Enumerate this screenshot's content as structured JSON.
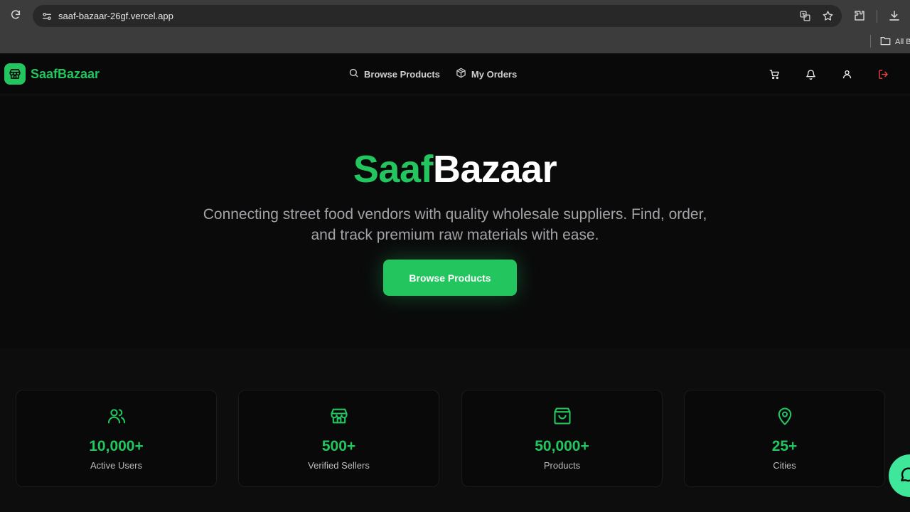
{
  "browser": {
    "url": "saaf-bazaar-26gf.vercel.app",
    "bookmarks_label": "All B"
  },
  "navbar": {
    "brand": "SaafBazaar",
    "links": [
      {
        "label": "Browse Products",
        "icon": "search-icon"
      },
      {
        "label": "My Orders",
        "icon": "package-icon"
      }
    ],
    "icons": [
      "cart-icon",
      "bell-icon",
      "user-icon",
      "logout-icon"
    ]
  },
  "hero": {
    "title_part1": "Saaf",
    "title_part2": "Bazaar",
    "subtitle": "Connecting street food vendors with quality wholesale suppliers. Find, order, and track premium raw materials with ease.",
    "cta_label": "Browse Products"
  },
  "stats": [
    {
      "value": "10,000+",
      "label": "Active Users",
      "icon": "users-icon"
    },
    {
      "value": "500+",
      "label": "Verified Sellers",
      "icon": "store-icon"
    },
    {
      "value": "50,000+",
      "label": "Products",
      "icon": "shopping-bag-icon"
    },
    {
      "value": "25+",
      "label": "Cities",
      "icon": "map-pin-icon"
    }
  ],
  "colors": {
    "accent": "#22c55e",
    "background": "#0a0a0b",
    "logout": "#ef4444"
  }
}
